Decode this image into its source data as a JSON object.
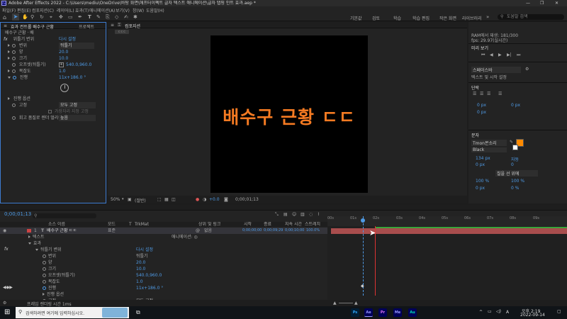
{
  "window": {
    "title": "Adobe After Effects 2022 - C:\\Users\\mediu\\OneDrive\\바탕 화면\\애프터이펙트 글자 텍스트 애니메이션\\글자 탭핑 인트 효과.aep *",
    "controls": [
      "—",
      "❐",
      "✕"
    ]
  },
  "menu": [
    "파일(F)",
    "편집(E)",
    "컴포지션(C)",
    "레이어(L)",
    "효과(T)",
    "애니메이션(A)",
    "보기(V)",
    "창(W)",
    "도움말(H)"
  ],
  "workspaces": [
    "기본값",
    "검토",
    "학습",
    "학습 편집",
    "작은 화면",
    "라이브러리"
  ],
  "search_help_placeholder": "도움말 검색",
  "effects_panel": {
    "tab_title": "효과 컨트롤 배수구 근황",
    "tab_project": "프로젝트",
    "subheader": "배수구 근황 · 배",
    "fx_name": "위틀기 변위",
    "reset": "다시 설정",
    "rows": [
      {
        "label": "변위",
        "value": "뒤틀기"
      },
      {
        "label": "양",
        "value": "20.0"
      },
      {
        "label": "크기",
        "value": "10.0"
      },
      {
        "label": "오프셋(뒤틀기)",
        "value": "540.0,960.0"
      },
      {
        "label": "복잡도",
        "value": "1.0"
      },
      {
        "label": "진행",
        "value": "11x+186.0 °"
      }
    ],
    "extra": [
      {
        "label": "진행 옵션",
        "value": ""
      },
      {
        "label": "고정",
        "value": "모두 고정"
      },
      {
        "label": "",
        "value": "가장자리 지정 고정"
      },
      {
        "label": "회고 품질로 렌더 멀리야",
        "value": "높음"
      }
    ]
  },
  "comp_panel": {
    "tab": "컴포지션",
    "comp_name": "배수구 근황 ㄷㄷ",
    "canvas_text": "배수구 근황 ㄷㄷ",
    "zoom": "50%",
    "resolution": "(절반)",
    "exposure": "+0.0",
    "timecode": "0;00;01;13"
  },
  "right_panel": {
    "info": [
      "RAM에서 재생: 181/300",
      "fps: 29.97(실시간)"
    ],
    "preview_title": "미리 보기",
    "paragraph_label": "단락",
    "font_label": "문자",
    "font_name": "Tmon몬소리",
    "font_style": "Black",
    "sizes": [
      "134 px",
      "자동",
      "0 px",
      "0"
    ],
    "scale": [
      "100 %",
      "100 %"
    ],
    "baseline": [
      "0 px",
      "0 %"
    ],
    "unit": "스페이스바",
    "align_label": "맞춤",
    "text_mode": "텍스트 및 시작 설정",
    "para_spacing": [
      "0 px",
      "0 px",
      "0 px"
    ],
    "stroke_option": "칠을 선 위에",
    "colors": {
      "fill": "#ff8a00",
      "stroke": "#ffffff"
    }
  },
  "timeline": {
    "timecode": "0;00;01;13",
    "columns": [
      "소스 이름",
      "모드",
      "T",
      "TrkMat",
      "상위 및 링크",
      "시작",
      "종료",
      "지속 시간",
      "스트레치"
    ],
    "ruler": [
      "00s",
      "01s",
      "02s",
      "03s",
      "04s",
      "05s",
      "06s",
      "07s",
      "08s",
      "09s"
    ],
    "layer": {
      "num": "1",
      "name": "배수구 근황 ㄷㄷ",
      "mode": "표준",
      "parent": "없음",
      "start": "0;00;00;00",
      "end": "0;00;09;29",
      "duration": "0;00;10;00",
      "stretch": "100.0%"
    },
    "tree": [
      {
        "indent": 1,
        "label": "텍스트",
        "value": "애니메이션: ◎"
      },
      {
        "indent": 1,
        "label": "효과",
        "value": ""
      },
      {
        "indent": 2,
        "label": "뒤틀기 변위",
        "value": "다시 설정"
      },
      {
        "indent": 3,
        "label": "변위",
        "value": "뒤틀기"
      },
      {
        "indent": 3,
        "label": "양",
        "value": "20.0"
      },
      {
        "indent": 3,
        "label": "크기",
        "value": "10.0"
      },
      {
        "indent": 3,
        "label": "오프셋(뒤틀기)",
        "value": "540.0,960.0"
      },
      {
        "indent": 3,
        "label": "복잡도",
        "value": "1.0"
      },
      {
        "indent": 3,
        "label": "진행",
        "value": "11x+186.0 °"
      },
      {
        "indent": 3,
        "label": "진행 옵션",
        "value": ""
      },
      {
        "indent": 3,
        "label": "고정",
        "value": "모두 고정"
      }
    ],
    "footer": "프레임 렌더링 시간 1ms"
  },
  "taskbar": {
    "search_placeholder": "검색하려면 여기에 입력하십시오.",
    "apps": [
      "Ps",
      "Ae",
      "Pr",
      "Me",
      "Au"
    ],
    "app_colors": [
      "#31a8ff",
      "#9999ff",
      "#ea77ff",
      "#9999ff",
      "#00e4bb"
    ],
    "language": "A",
    "time": "오후 2:19",
    "date": "2022-09-14"
  }
}
